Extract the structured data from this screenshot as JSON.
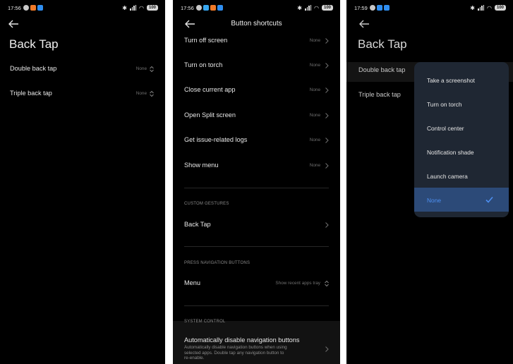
{
  "colors": {
    "accent": "#4d8ff0",
    "selected_bg": "#2c4a78",
    "popup_bg": "#1f2733",
    "background": "#000000"
  },
  "screen1": {
    "time": "17:56",
    "battery": "100",
    "title": "Back Tap",
    "rows": [
      {
        "label": "Double back tap",
        "value": "None"
      },
      {
        "label": "Triple back tap",
        "value": "None"
      }
    ]
  },
  "screen2": {
    "time": "17:56",
    "battery": "100",
    "title": "Button shortcuts",
    "rows": [
      {
        "label": "Turn off screen",
        "value": "None"
      },
      {
        "label": "Turn on torch",
        "value": "None"
      },
      {
        "label": "Close current app",
        "value": "None"
      },
      {
        "label": "Open Split screen",
        "value": "None"
      },
      {
        "label": "Get issue-related logs",
        "value": "None"
      },
      {
        "label": "Show menu",
        "value": "None"
      }
    ],
    "custom_gestures": {
      "header": "CUSTOM GESTURES",
      "item": "Back Tap"
    },
    "nav_buttons": {
      "header": "PRESS NAVIGATION BUTTONS",
      "item": "Menu",
      "value": "Show recent apps tray"
    },
    "system_control": {
      "header": "SYSTEM CONTROL",
      "item": "Automatically disable navigation buttons",
      "desc_lines": [
        "Automatically disable navigation buttons when using",
        "selected apps. Double tap any navigation button to",
        "re-enable."
      ]
    }
  },
  "screen3": {
    "time": "17:59",
    "battery": "100",
    "title": "Back Tap",
    "rows": [
      {
        "label": "Double back tap"
      },
      {
        "label": "Triple back tap"
      }
    ],
    "options": [
      "Take a screenshot",
      "Turn on torch",
      "Control center",
      "Notification shade",
      "Launch camera",
      "None"
    ],
    "selected_option": "None"
  }
}
